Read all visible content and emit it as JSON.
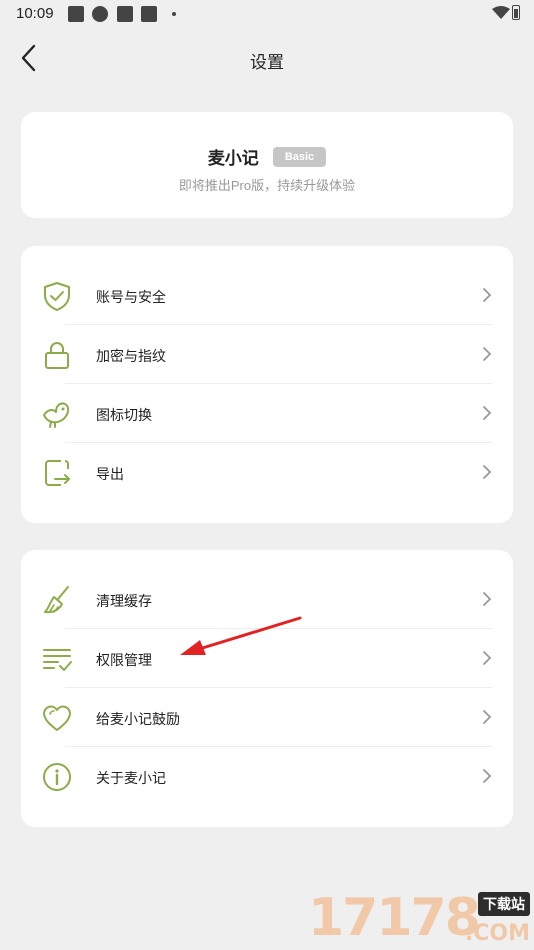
{
  "status_bar": {
    "time": "10:09"
  },
  "header": {
    "title": "设置"
  },
  "profile": {
    "app_name": "麦小记",
    "badge": "Basic",
    "subtitle": "即将推出Pro版，持续升级体验"
  },
  "group1": [
    {
      "label": "账号与安全",
      "icon": "shield-check-icon"
    },
    {
      "label": "加密与指纹",
      "icon": "lock-icon"
    },
    {
      "label": "图标切换",
      "icon": "bird-icon"
    },
    {
      "label": "导出",
      "icon": "export-icon"
    }
  ],
  "group2": [
    {
      "label": "清理缓存",
      "icon": "broom-icon"
    },
    {
      "label": "权限管理",
      "icon": "list-check-icon"
    },
    {
      "label": "给麦小记鼓励",
      "icon": "heart-icon"
    },
    {
      "label": "关于麦小记",
      "icon": "info-icon"
    }
  ],
  "watermark": {
    "number": "17178",
    "tag": "下载站",
    "suffix": ".COM"
  },
  "colors": {
    "accent": "#8aad4a",
    "annotation_arrow": "#e02424",
    "background": "#efefef"
  }
}
